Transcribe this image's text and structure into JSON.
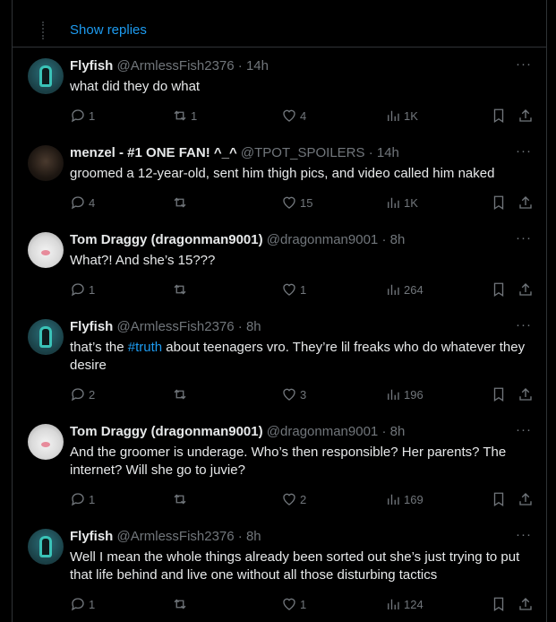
{
  "thread": {
    "show_replies": "Show replies"
  },
  "tweets": [
    {
      "name": "Flyfish",
      "handle": "@ArmlessFish2376",
      "time": "· 14h",
      "text": "what did they do what",
      "replies": "1",
      "retweets": "1",
      "likes": "4",
      "views": "1K",
      "avatar": "fish"
    },
    {
      "name": "menzel - #1 ONE FAN! ^_^",
      "handle": "@TPOT_SPOILERS",
      "time": "· 14h",
      "text": "groomed a 12-year-old, sent him thigh pics, and video called him naked",
      "replies": "4",
      "retweets": "",
      "likes": "15",
      "views": "1K",
      "avatar": "dark"
    },
    {
      "name": "Tom Draggy (dragonman9001)",
      "handle": "@dragonman9001",
      "time": "· 8h",
      "text": "What?! And she’s 15???",
      "replies": "1",
      "retweets": "",
      "likes": "1",
      "views": "264",
      "avatar": "cat"
    },
    {
      "name": "Flyfish",
      "handle": "@ArmlessFish2376",
      "time": "· 8h",
      "text_before": "that’s the ",
      "hashtag": "#truth",
      "text_after": " about teenagers vro. They’re lil freaks who do whatever they desire",
      "replies": "2",
      "retweets": "",
      "likes": "3",
      "views": "196",
      "avatar": "fish"
    },
    {
      "name": "Tom Draggy (dragonman9001)",
      "handle": "@dragonman9001",
      "time": "· 8h",
      "text": "And the groomer is underage. Who’s then responsible? Her parents? The internet? Will she go to juvie?",
      "replies": "1",
      "retweets": "",
      "likes": "2",
      "views": "169",
      "avatar": "cat"
    },
    {
      "name": "Flyfish",
      "handle": "@ArmlessFish2376",
      "time": "· 8h",
      "text": "Well I mean the whole things already been sorted out she’s just trying to put that life behind and live one without all those disturbing tactics",
      "replies": "1",
      "retweets": "",
      "likes": "1",
      "views": "124",
      "avatar": "fish"
    }
  ],
  "icons": {
    "reply": "reply-icon",
    "retweet": "retweet-icon",
    "like": "heart-icon",
    "views": "views-icon",
    "bookmark": "bookmark-icon",
    "share": "share-icon",
    "more": "more-icon"
  },
  "colors": {
    "background": "#000000",
    "text": "#e7e9ea",
    "muted": "#71767b",
    "link": "#1d9bf0",
    "border": "#2f3336"
  }
}
